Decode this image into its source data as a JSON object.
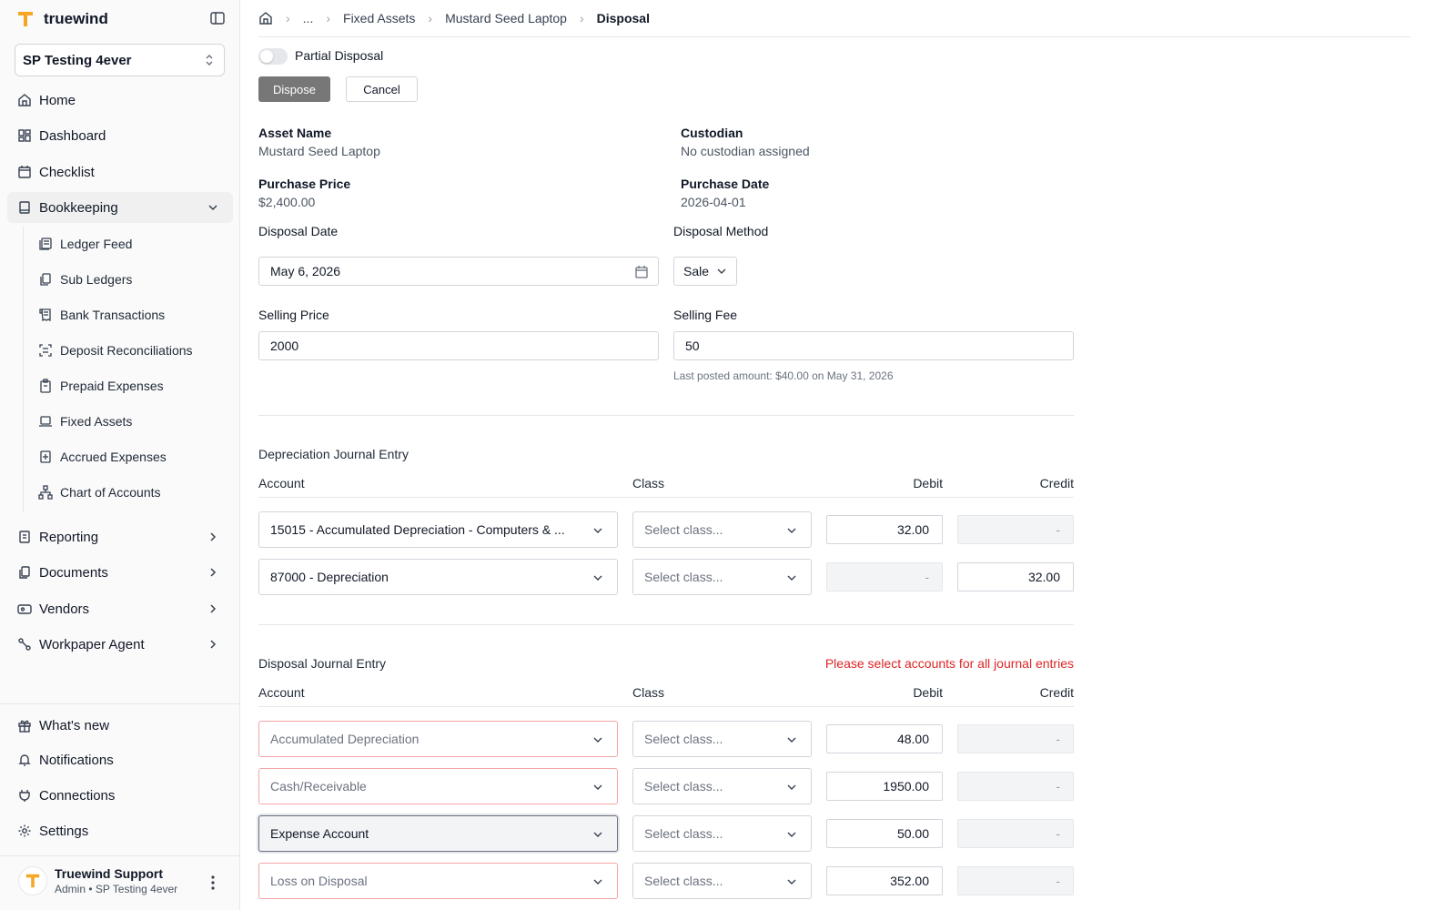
{
  "app": {
    "brand": "truewind",
    "company": "SP Testing 4ever",
    "accent": "#f5a623"
  },
  "nav": {
    "home": "Home",
    "dashboard": "Dashboard",
    "checklist": "Checklist",
    "bookkeeping": "Bookkeeping",
    "bookkeeping_items": [
      "Ledger Feed",
      "Sub Ledgers",
      "Bank Transactions",
      "Deposit Reconciliations",
      "Prepaid Expenses",
      "Fixed Assets",
      "Accrued Expenses",
      "Chart of Accounts"
    ],
    "reporting": "Reporting",
    "documents": "Documents",
    "vendors": "Vendors",
    "workpaper_agent": "Workpaper Agent",
    "whats_new": "What's new",
    "notifications": "Notifications",
    "connections": "Connections",
    "settings": "Settings"
  },
  "user": {
    "name": "Truewind Support",
    "role": "Admin • SP Testing 4ever"
  },
  "breadcrumb": {
    "ellipsis": "...",
    "items": [
      "Fixed Assets",
      "Mustard Seed Laptop",
      "Disposal"
    ]
  },
  "form": {
    "partial_disposal_label": "Partial Disposal",
    "partial_disposal_on": false,
    "dispose_label": "Dispose",
    "cancel_label": "Cancel",
    "asset_name_label": "Asset Name",
    "asset_name": "Mustard Seed Laptop",
    "custodian_label": "Custodian",
    "custodian": "No custodian assigned",
    "purchase_price_label": "Purchase Price",
    "purchase_price": "$2,400.00",
    "purchase_date_label": "Purchase Date",
    "purchase_date": "2026-04-01",
    "disposal_date_label": "Disposal Date",
    "disposal_date": "May 6, 2026",
    "disposal_method_label": "Disposal Method",
    "disposal_method": "Sale",
    "selling_price_label": "Selling Price",
    "selling_price": "2000",
    "selling_fee_label": "Selling Fee",
    "selling_fee": "50",
    "selling_fee_hint": "Last posted amount: $40.00 on May 31, 2026"
  },
  "columns": {
    "account": "Account",
    "class": "Class",
    "debit": "Debit",
    "credit": "Credit"
  },
  "class_placeholder": "Select class...",
  "depreciation": {
    "title": "Depreciation Journal Entry",
    "rows": [
      {
        "account": "15015 - Accumulated Depreciation - Computers & ...",
        "debit": "32.00",
        "credit": "-"
      },
      {
        "account": "87000 - Depreciation",
        "debit": "-",
        "credit": "32.00"
      }
    ]
  },
  "disposal": {
    "title": "Disposal Journal Entry",
    "error": "Please select accounts for all journal entries",
    "rows": [
      {
        "account": "Accumulated Depreciation",
        "debit": "48.00",
        "credit": "-"
      },
      {
        "account": "Cash/Receivable",
        "debit": "1950.00",
        "credit": "-"
      },
      {
        "account": "Expense Account",
        "debit": "50.00",
        "credit": "-"
      },
      {
        "account": "Loss on Disposal",
        "debit": "352.00",
        "credit": "-"
      }
    ]
  }
}
